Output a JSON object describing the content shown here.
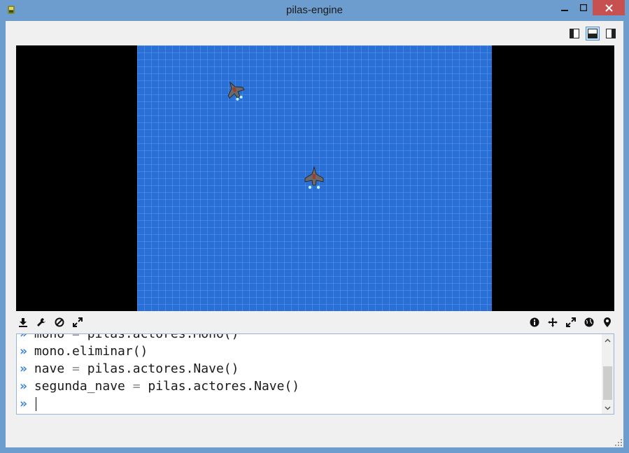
{
  "window": {
    "title": "pilas-engine",
    "icon": "pilas-app-icon",
    "controls": {
      "minimize": "minimize-icon",
      "maximize": "maximize-icon",
      "close": "close-icon"
    },
    "close_color": "#c75050"
  },
  "layout_buttons": [
    "layout-left-panel-icon",
    "layout-bottom-panel-icon",
    "layout-right-panel-icon"
  ],
  "stage": {
    "background": "#2a6fd6",
    "actors": [
      "ship-actor",
      "second-ship-actor"
    ]
  },
  "toolbar": {
    "left": [
      "download-icon",
      "wrench-icon",
      "stop-icon",
      "fullscreen-icon"
    ],
    "right": [
      "info-icon",
      "move-icon",
      "expand-icon",
      "globe-icon",
      "location-pin-icon"
    ]
  },
  "console": {
    "prompt": "»",
    "lines": [
      {
        "var": "mono",
        "op": " = ",
        "expr": "pilas.actores.Mono()"
      },
      {
        "var": "",
        "op": "",
        "expr": "mono.eliminar()"
      },
      {
        "var": "nave",
        "op": " = ",
        "expr": "pilas.actores.Nave()"
      },
      {
        "var": "segunda_nave",
        "op": " = ",
        "expr": "pilas.actores.Nave()"
      }
    ],
    "input": ""
  }
}
